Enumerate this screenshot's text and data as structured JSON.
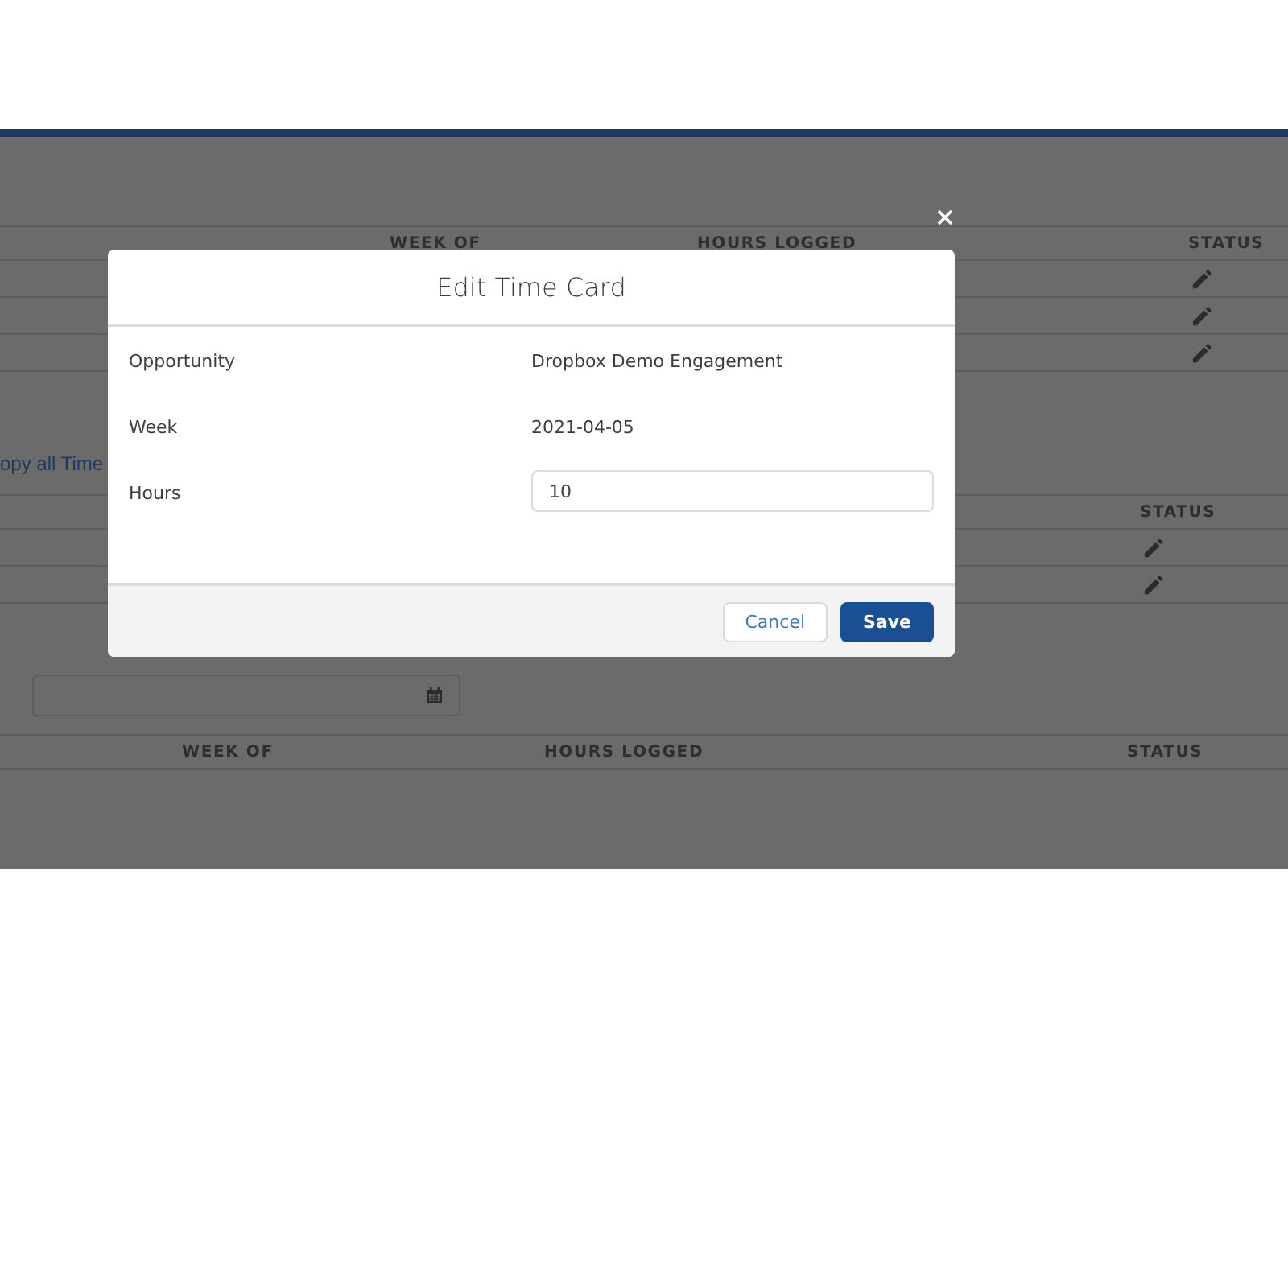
{
  "background": {
    "tables": [
      {
        "columns": [
          {
            "label": "WEEK OF"
          },
          {
            "label": "HOURS LOGGED"
          },
          {
            "label": "STATUS"
          }
        ],
        "kind": "wide",
        "rows": [
          {
            "kind": "edit"
          },
          {
            "kind": "edit"
          },
          {
            "kind": "edit"
          }
        ]
      },
      {
        "columns": [
          {
            "label": "STATUS"
          }
        ],
        "kind": "status_only",
        "rows": [
          {
            "kind": "edit"
          },
          {
            "kind": "edit"
          }
        ]
      },
      {
        "columns": [
          {
            "label": "WEEK OF"
          },
          {
            "label": "HOURS LOGGED"
          },
          {
            "label": "STATUS"
          }
        ],
        "kind": "narrow"
      }
    ],
    "link": "opy all Time"
  },
  "modal": {
    "title": "Edit Time Card",
    "fields": [
      {
        "label": "Opportunity",
        "kind": "text",
        "value": "Dropbox Demo Engagement"
      },
      {
        "label": "Week",
        "kind": "text",
        "value": "2021-04-05"
      },
      {
        "label": "Hours",
        "kind": "input",
        "value": "10"
      }
    ],
    "buttons": [
      {
        "label": "Cancel",
        "kind": "neutral"
      },
      {
        "label": "Save",
        "kind": "brand"
      }
    ]
  }
}
